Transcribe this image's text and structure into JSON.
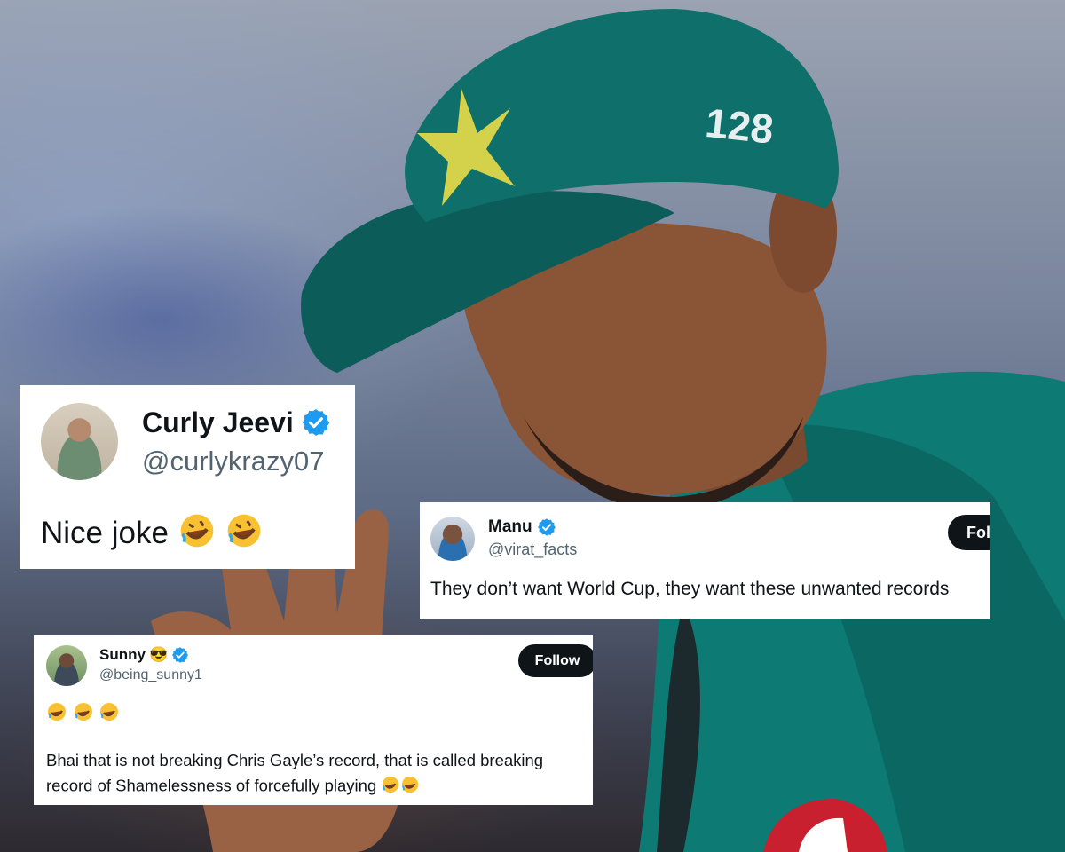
{
  "tweets": [
    {
      "name": "Curly Jeevi",
      "handle": "@curlykrazy07",
      "text": "Nice joke",
      "emojis": "rofl-rofl",
      "verified": true
    },
    {
      "name": "Manu",
      "handle": "@virat_facts",
      "text": "They don’t want World Cup, they want these unwanted records",
      "follow_label": "Fol",
      "verified": true
    },
    {
      "name": "Sunny",
      "name_emoji": "😎",
      "handle": "@being_sunny1",
      "emoji_line": "rofl-rofl-rofl",
      "text_line1": "Bhai that is not breaking Chris Gayle’s record, that is called breaking",
      "text_line2": "record of Shamelessness of forcefully playing",
      "follow_label": "Follow",
      "verified": true
    }
  ],
  "photo": {
    "cap_number": "128",
    "cap_color": "#0f6f6b",
    "jersey_color": "#0d7a73"
  },
  "colors": {
    "verified": "#1d9bf0",
    "handle": "#536471",
    "text": "#0f1419",
    "follow_bg": "#0f1419"
  }
}
